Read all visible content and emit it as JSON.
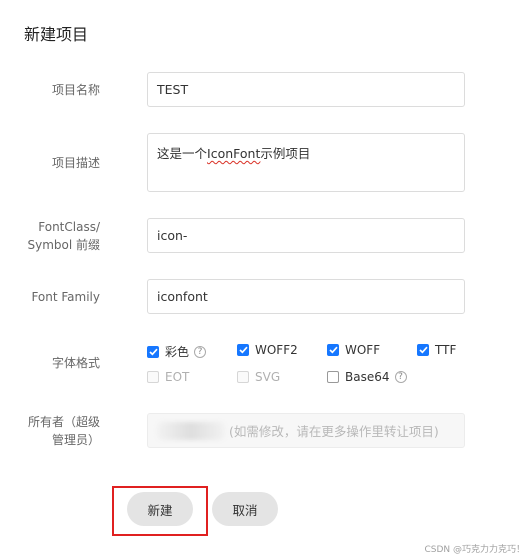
{
  "page": {
    "title": "新建项目"
  },
  "form": {
    "name": {
      "label": "项目名称",
      "value": "TEST"
    },
    "description": {
      "label": "项目描述",
      "value_plain": "这是一个",
      "value_underlined": "IconFont",
      "value_rest": "示例项目"
    },
    "prefix": {
      "label_line1": "FontClass/",
      "label_line2": "Symbol 前缀",
      "value": "icon-"
    },
    "font_family": {
      "label": "Font Family",
      "value": "iconfont"
    },
    "font_format": {
      "label": "字体格式",
      "options": [
        {
          "label": "彩色",
          "checked": true,
          "disabled": false,
          "help": "?"
        },
        {
          "label": "WOFF2",
          "checked": true,
          "disabled": false
        },
        {
          "label": "WOFF",
          "checked": true,
          "disabled": false
        },
        {
          "label": "TTF",
          "checked": true,
          "disabled": false
        },
        {
          "label": "EOT",
          "checked": false,
          "disabled": true
        },
        {
          "label": "SVG",
          "checked": false,
          "disabled": true
        },
        {
          "label": "Base64",
          "checked": false,
          "disabled": false,
          "help": "?"
        }
      ]
    },
    "owner": {
      "label_line1": "所有者（超级",
      "label_line2": "管理员）",
      "hint": "(如需修改，请在更多操作里转让项目)"
    }
  },
  "actions": {
    "create_label": "新建",
    "cancel_label": "取消"
  },
  "watermark": "CSDN @巧克力力克巧！",
  "colors": {
    "accent": "#1677ff",
    "highlight": "#e02020",
    "button_bg": "#e4e4e4"
  }
}
